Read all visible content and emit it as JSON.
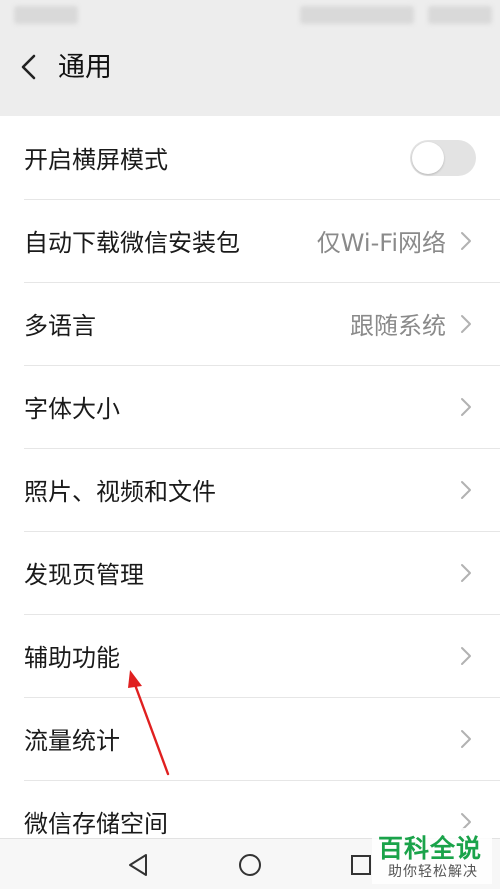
{
  "header": {
    "title": "通用",
    "back_icon": "chevron-left-icon"
  },
  "settings": {
    "items": [
      {
        "label": "开启横屏模式",
        "control": "toggle",
        "toggle_on": false
      },
      {
        "label": "自动下载微信安装包",
        "value": "仅Wi-Fi网络",
        "icon": "chevron-right-icon"
      },
      {
        "label": "多语言",
        "value": "跟随系统",
        "icon": "chevron-right-icon"
      },
      {
        "label": "字体大小",
        "icon": "chevron-right-icon"
      },
      {
        "label": "照片、视频和文件",
        "icon": "chevron-right-icon"
      },
      {
        "label": "发现页管理",
        "icon": "chevron-right-icon"
      },
      {
        "label": "辅助功能",
        "icon": "chevron-right-icon"
      },
      {
        "label": "流量统计",
        "icon": "chevron-right-icon"
      },
      {
        "label": "微信存储空间",
        "icon": "chevron-right-icon"
      }
    ]
  },
  "nav_bar": {
    "icons": [
      "back-triangle-icon",
      "home-circle-icon",
      "recents-square-icon"
    ]
  },
  "watermark": {
    "title": "百科全说",
    "subtitle": "助你轻松解决",
    "color": "#1aa34a"
  },
  "annotation": {
    "arrow_color": "#e02020"
  },
  "colors": {
    "background": "#ededed",
    "list_background": "#ffffff",
    "secondary_text": "#8a8a8a"
  }
}
